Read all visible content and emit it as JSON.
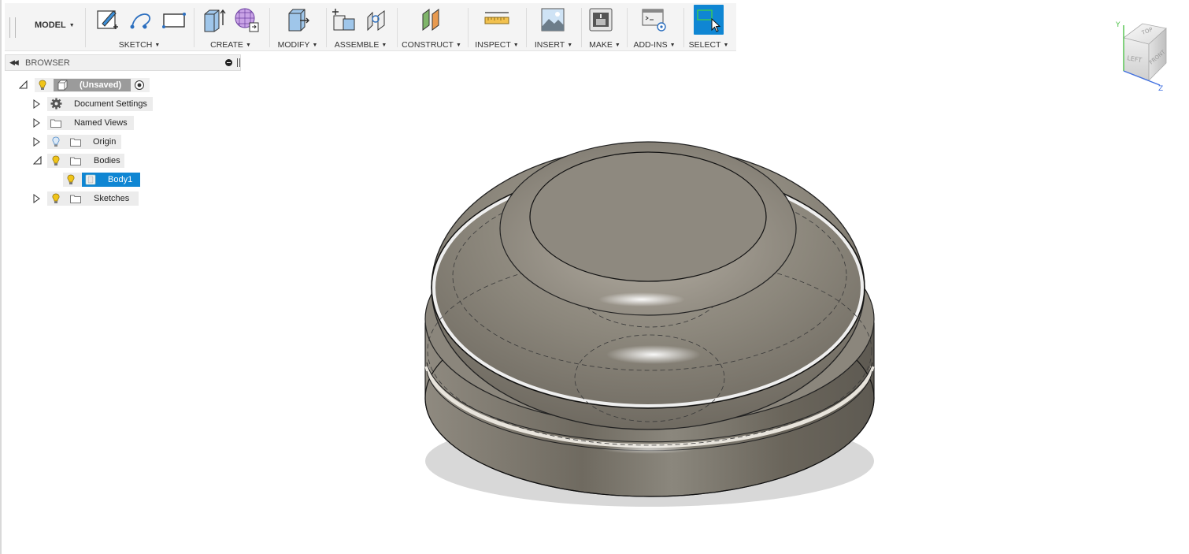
{
  "toolbar": {
    "workspace": "MODEL",
    "groups": [
      {
        "label": "SKETCH"
      },
      {
        "label": "CREATE"
      },
      {
        "label": "MODIFY"
      },
      {
        "label": "ASSEMBLE"
      },
      {
        "label": "CONSTRUCT"
      },
      {
        "label": "INSPECT"
      },
      {
        "label": "INSERT"
      },
      {
        "label": "MAKE"
      },
      {
        "label": "ADD-INS"
      },
      {
        "label": "SELECT"
      }
    ]
  },
  "browser": {
    "title": "BROWSER",
    "root": {
      "label": "(Unsaved)"
    },
    "nodes": [
      {
        "label": "Document Settings",
        "icon": "gear-icon"
      },
      {
        "label": "Named Views",
        "icon": "folder-icon"
      },
      {
        "label": "Origin",
        "icon": "folder-icon"
      },
      {
        "label": "Bodies",
        "icon": "folder-icon",
        "children": [
          {
            "label": "Body1",
            "selected": true
          }
        ]
      },
      {
        "label": "Sketches",
        "icon": "folder-icon"
      }
    ]
  },
  "viewcube": {
    "top": "TOP",
    "left": "LEFT",
    "front": "FRONT",
    "axes": [
      "Y",
      "Z"
    ]
  },
  "colors": {
    "accent": "#0f86d3",
    "bulb": "#f0c419",
    "body": "#8a857c"
  }
}
